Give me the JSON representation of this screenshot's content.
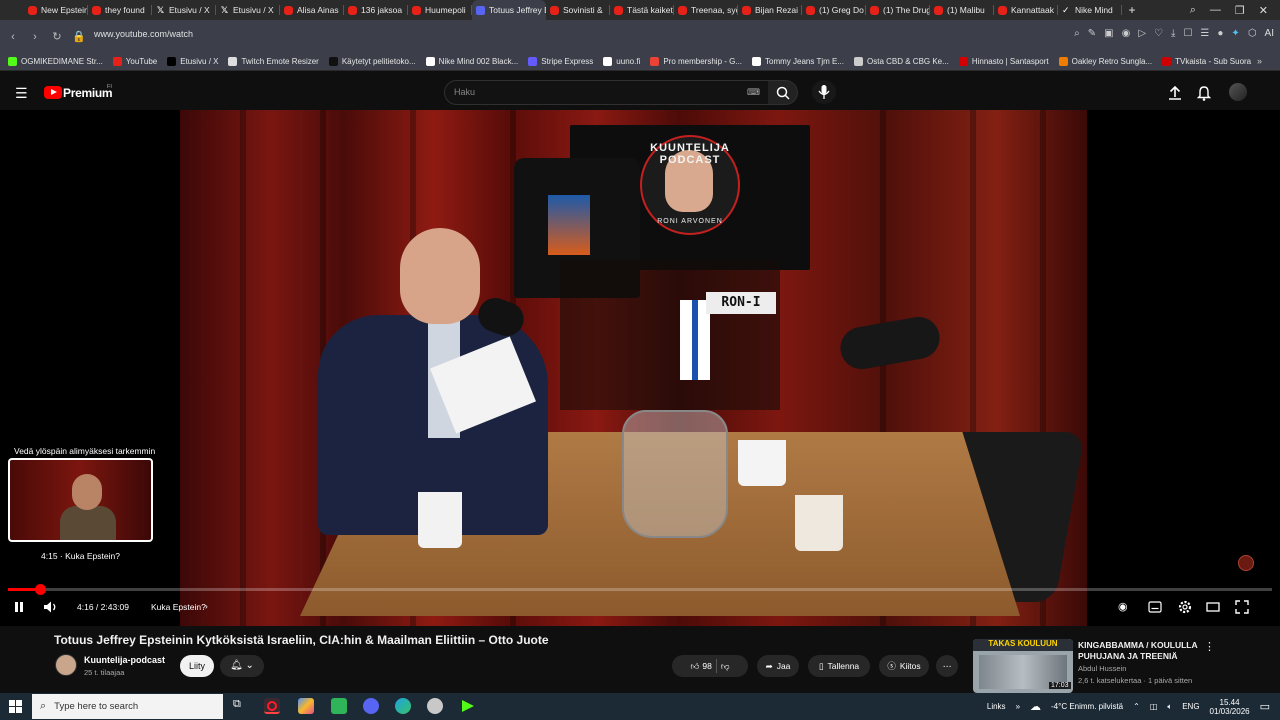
{
  "browser": {
    "tabs": [
      {
        "label": "New Epstein",
        "icon": "youtube-icon"
      },
      {
        "label": "they found",
        "icon": "youtube-icon"
      },
      {
        "label": "Etusivu / X",
        "icon": "x-icon"
      },
      {
        "label": "Etusivu / X",
        "icon": "x-icon"
      },
      {
        "label": "Alisa Ainas",
        "icon": "youtube-icon"
      },
      {
        "label": "136 jaksoa",
        "icon": "youtube-icon"
      },
      {
        "label": "Huumepoli",
        "icon": "youtube-icon"
      },
      {
        "label": "Totuus Jeffrey Ep",
        "icon": "audio-icon",
        "active": true
      },
      {
        "label": "Sovinisti &",
        "icon": "youtube-icon"
      },
      {
        "label": "Tästä kaiket",
        "icon": "youtube-icon"
      },
      {
        "label": "Treenaa, syö",
        "icon": "youtube-icon"
      },
      {
        "label": "Bijan Rezai",
        "icon": "youtube-icon"
      },
      {
        "label": "(1) Greg Do",
        "icon": "youtube-icon"
      },
      {
        "label": "(1) The Drug",
        "icon": "youtube-icon"
      },
      {
        "label": "(1) Malibu",
        "icon": "youtube-icon"
      },
      {
        "label": "Kannattaak",
        "icon": "youtube-icon"
      },
      {
        "label": "Nike Mind",
        "icon": "nike-icon"
      }
    ],
    "new_tab_label": "+",
    "url": "www.youtube.com/watch",
    "ai_label": "AI",
    "bookmarks": [
      {
        "label": "OGMIKEDIMANE Str...",
        "color": "#53fc18"
      },
      {
        "label": "YouTube",
        "color": "#e62117"
      },
      {
        "label": "Etusivu / X",
        "color": "#000000"
      },
      {
        "label": "Twitch Emote Resizer",
        "color": "#dddddd"
      },
      {
        "label": "Käytetyt pelitietoko...",
        "color": "#111111"
      },
      {
        "label": "Nike Mind 002 Black...",
        "color": "#ffffff"
      },
      {
        "label": "Stripe Express",
        "color": "#635bff"
      },
      {
        "label": "uuno.fi",
        "color": "#ffffff"
      },
      {
        "label": "Pro membership - G...",
        "color": "#ea4335"
      },
      {
        "label": "Tommy Jeans Tjm E...",
        "color": "#ffffff"
      },
      {
        "label": "Osta CBD & CBG Ke...",
        "color": "#cccccc"
      },
      {
        "label": "Hinnasto | Santasport",
        "color": "#d40000"
      },
      {
        "label": "Oakley Retro Sungla...",
        "color": "#f07c00"
      },
      {
        "label": "TVkaista - Sub Suora",
        "color": "#cc0000"
      }
    ]
  },
  "youtube": {
    "brand": "Premium",
    "brand_sup": "FI",
    "search_placeholder": "Haku",
    "video": {
      "board_text": "KUUNTELIJA PODCAST",
      "board_sub": "RONI ARVONEN",
      "plate_text": "RON-I",
      "hover_hint": "Vedä ylöspäin alimyäksesi tarkemmin",
      "hover_time": "4:15 · Kuka Epstein?",
      "time": "4:16 / 2:43:09",
      "chapter": "Kuka Epstein?",
      "progress": 0.026
    },
    "title": "Totuus Jeffrey Epsteinin Kytköksistä Israeliin, CIA:hin & Maailman Eliittiin – Otto Juote",
    "channel": {
      "name": "Kuuntelija-podcast",
      "subs": "25 t. tilaajaa",
      "join_label": "Liity"
    },
    "actions": {
      "likes": "98",
      "share": "Jaa",
      "save": "Tallenna",
      "thanks": "Kiitos"
    },
    "recommendation": {
      "thumb_text": "TAKAS KOULUUN",
      "duration": "17:03",
      "title": "KINGABBAMMA / KOULULLA PUHUJANA JA TREENIÄ",
      "channel": "Abdul Hussein",
      "meta": "2,6 t. katselukertaa · 1 päivä sitten"
    }
  },
  "taskbar": {
    "search_placeholder": "Type here to search",
    "links": "Links",
    "weather": "-4°C  Enimm. pilvistä",
    "lang": "ENG",
    "time": "15.44",
    "date": "01/03/2026"
  }
}
